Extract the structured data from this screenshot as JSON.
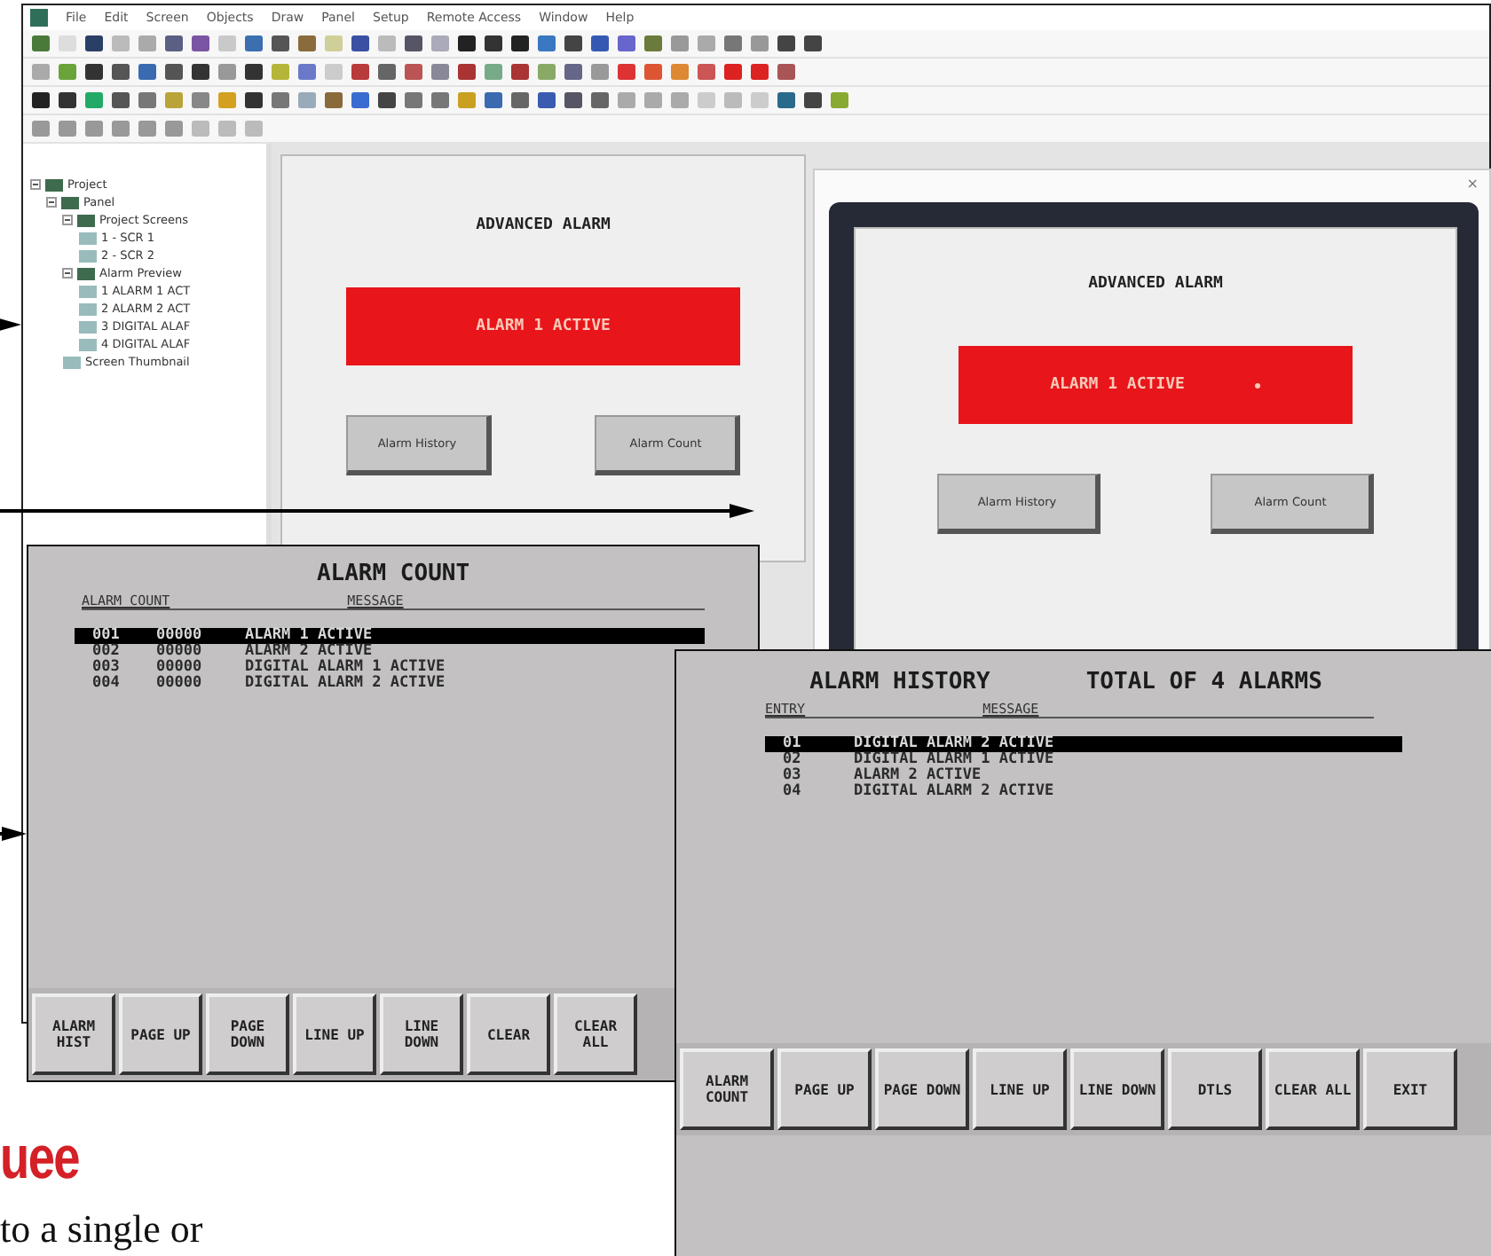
{
  "editor": {
    "menu": [
      "File",
      "Edit",
      "Screen",
      "Objects",
      "Draw",
      "Panel",
      "Setup",
      "Remote Access",
      "Window",
      "Help"
    ],
    "tree": [
      {
        "label": "Project",
        "expanded": true,
        "children": [
          {
            "label": "Panel",
            "expanded": true,
            "children": [
              {
                "label": "Project Screens",
                "expanded": true,
                "children": [
                  {
                    "label": "1 - SCR 1"
                  },
                  {
                    "label": "2 - SCR 2"
                  }
                ]
              },
              {
                "label": "Alarm Preview",
                "expanded": true,
                "children": [
                  {
                    "label": "1 ALARM 1 ACT"
                  },
                  {
                    "label": "2 ALARM 2 ACT"
                  },
                  {
                    "label": "3 DIGITAL ALAF"
                  },
                  {
                    "label": "4 DIGITAL ALAF"
                  }
                ]
              },
              {
                "label": "Screen Thumbnail"
              }
            ]
          }
        ]
      }
    ],
    "canvas": {
      "title": "ADVANCED ALARM",
      "banner": "ALARM 1 ACTIVE",
      "buttons": [
        "Alarm History",
        "Alarm Count"
      ]
    }
  },
  "simulator": {
    "close": "×",
    "screen": {
      "title": "ADVANCED ALARM",
      "banner": "ALARM 1 ACTIVE",
      "buttons": [
        "Alarm History",
        "Alarm Count"
      ]
    }
  },
  "alarm_count": {
    "title": "ALARM COUNT",
    "columns": [
      "ALARM COUNT",
      "MESSAGE"
    ],
    "rows": [
      {
        "cells": [
          "001",
          "00000",
          "ALARM 1 ACTIVE"
        ],
        "selected": true
      },
      {
        "cells": [
          "002",
          "00000",
          "ALARM 2 ACTIVE"
        ],
        "selected": false
      },
      {
        "cells": [
          "003",
          "00000",
          "DIGITAL ALARM 1 ACTIVE"
        ],
        "selected": false
      },
      {
        "cells": [
          "004",
          "00000",
          "DIGITAL ALARM 2 ACTIVE"
        ],
        "selected": false
      }
    ],
    "keys": [
      "ALARM HIST",
      "PAGE UP",
      "PAGE DOWN",
      "LINE UP",
      "LINE DOWN",
      "CLEAR",
      "CLEAR ALL"
    ]
  },
  "alarm_history": {
    "title": "ALARM HISTORY",
    "total": "TOTAL OF 4 ALARMS",
    "columns": [
      "ENTRY",
      "MESSAGE"
    ],
    "rows": [
      {
        "cells": [
          "01",
          "DIGITAL ALARM 2 ACTIVE"
        ],
        "selected": true
      },
      {
        "cells": [
          "02",
          "DIGITAL ALARM 1 ACTIVE"
        ],
        "selected": false
      },
      {
        "cells": [
          "03",
          "ALARM 2 ACTIVE"
        ],
        "selected": false
      },
      {
        "cells": [
          "04",
          "DIGITAL ALARM 2 ACTIVE"
        ],
        "selected": false
      }
    ],
    "keys": [
      "ALARM COUNT",
      "PAGE UP",
      "PAGE DOWN",
      "LINE UP",
      "LINE DOWN",
      "DTLS",
      "CLEAR ALL",
      "EXIT"
    ]
  },
  "heading": "uee",
  "body": "to a single or"
}
